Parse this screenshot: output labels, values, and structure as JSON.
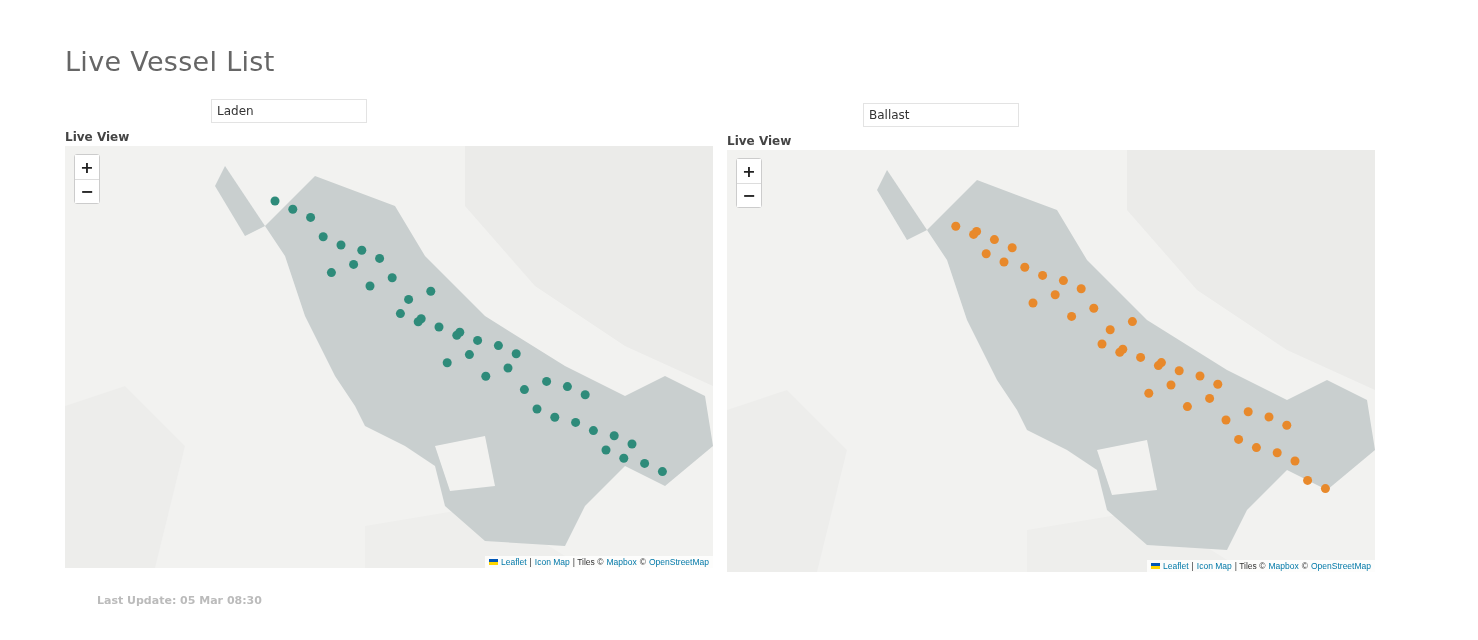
{
  "title": "Live Vessel List",
  "maps": [
    {
      "filter": "Laden",
      "label": "Live View",
      "color": "#2e8b7a",
      "zoom_in": "+",
      "zoom_out": "−",
      "attribution": [
        {
          "kind": "link",
          "text": "Leaflet"
        },
        {
          "kind": "text",
          "text": "|"
        },
        {
          "kind": "link",
          "text": "Icon Map"
        },
        {
          "kind": "text",
          "text": "| Tiles ©"
        },
        {
          "kind": "link",
          "text": "Mapbox"
        },
        {
          "kind": "text",
          "text": "©"
        },
        {
          "kind": "link",
          "text": "OpenStreetMap"
        }
      ]
    },
    {
      "filter": "Ballast",
      "label": "Live View",
      "color": "#e8892b",
      "zoom_in": "+",
      "zoom_out": "−",
      "attribution": [
        {
          "kind": "link",
          "text": "Leaflet"
        },
        {
          "kind": "text",
          "text": "|"
        },
        {
          "kind": "link",
          "text": "Icon Map"
        },
        {
          "kind": "text",
          "text": "| Tiles ©"
        },
        {
          "kind": "link",
          "text": "Mapbox"
        },
        {
          "kind": "text",
          "text": "©"
        },
        {
          "kind": "link",
          "text": "OpenStreetMap"
        }
      ]
    }
  ],
  "last_update": "Last Update: 05 Mar 08:30"
}
